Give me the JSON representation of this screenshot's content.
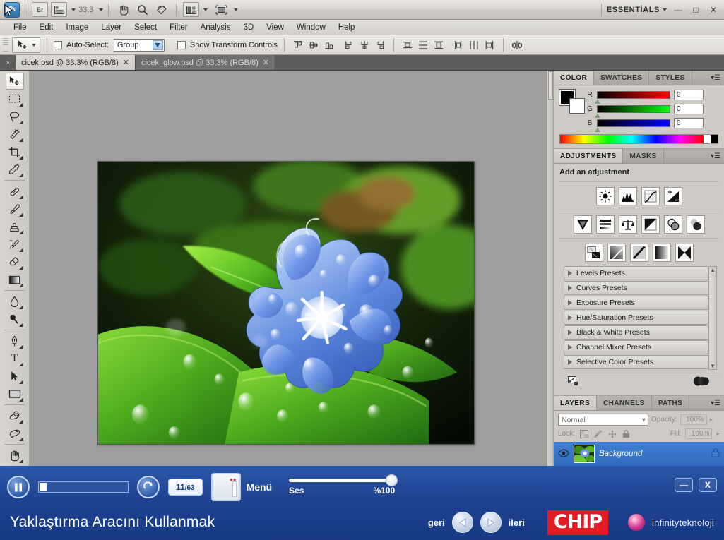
{
  "app": {
    "zoom_value": "33,3",
    "workspace_label": "ESSENTİALS",
    "logo_text": "Ps",
    "bridge_label": "Br"
  },
  "window_controls": {
    "minimize": "—",
    "maximize": "□",
    "close": "✕"
  },
  "menubar": {
    "items": [
      "File",
      "Edit",
      "Image",
      "Layer",
      "Select",
      "Filter",
      "Analysis",
      "3D",
      "View",
      "Window",
      "Help"
    ]
  },
  "options_bar": {
    "auto_select_label": "Auto-Select:",
    "auto_select_value": "Group",
    "show_transform_label": "Show Transform Controls",
    "align_icons": [
      "align-top-edges-icon",
      "align-vertical-centers-icon",
      "align-bottom-edges-icon",
      "align-left-edges-icon",
      "align-horizontal-centers-icon",
      "align-right-edges-icon",
      "distribute-top-edges-icon",
      "distribute-vertical-centers-icon",
      "distribute-bottom-edges-icon",
      "distribute-left-edges-icon",
      "distribute-horizontal-centers-icon",
      "distribute-right-edges-icon",
      "auto-align-layers-icon"
    ]
  },
  "tabs": [
    {
      "label": "cicek.psd @ 33,3% (RGB/8)",
      "active": true,
      "close": "✕"
    },
    {
      "label": "cicek_glow.psd @ 33,3% (RGB/8)",
      "active": false,
      "close": "✕"
    }
  ],
  "toolbox": {
    "tools": [
      {
        "name": "move-tool",
        "glyph": "move",
        "active": true
      },
      {
        "name": "rectangular-marquee-tool",
        "glyph": "marquee"
      },
      {
        "name": "lasso-tool",
        "glyph": "lasso"
      },
      {
        "name": "magic-wand-tool",
        "glyph": "wand"
      },
      {
        "name": "crop-tool",
        "glyph": "crop"
      },
      {
        "name": "eyedropper-tool",
        "glyph": "eyedropper"
      },
      {
        "name": "spot-healing-brush-tool",
        "glyph": "healing"
      },
      {
        "name": "brush-tool",
        "glyph": "brush"
      },
      {
        "name": "clone-stamp-tool",
        "glyph": "stamp"
      },
      {
        "name": "history-brush-tool",
        "glyph": "history"
      },
      {
        "name": "eraser-tool",
        "glyph": "eraser"
      },
      {
        "name": "gradient-tool",
        "glyph": "gradient"
      },
      {
        "name": "blur-tool",
        "glyph": "blur"
      },
      {
        "name": "dodge-tool",
        "glyph": "dodge"
      },
      {
        "name": "pen-tool",
        "glyph": "pen"
      },
      {
        "name": "horizontal-type-tool",
        "glyph": "type"
      },
      {
        "name": "path-selection-tool",
        "glyph": "pathsel"
      },
      {
        "name": "rectangle-tool",
        "glyph": "shape"
      },
      {
        "name": "3d-rotate-tool",
        "glyph": "rotate3d"
      },
      {
        "name": "3d-orbit-tool",
        "glyph": "orbit3d"
      },
      {
        "name": "hand-tool",
        "glyph": "hand"
      },
      {
        "name": "zoom-tool",
        "glyph": "zoom"
      }
    ],
    "foreground_color": "#000000",
    "background_color": "#ffffff"
  },
  "color_panel": {
    "tabs": [
      "COLOR",
      "SWATCHES",
      "STYLES"
    ],
    "active_tab": "COLOR",
    "channels": [
      {
        "label": "R",
        "value": "0",
        "from": "#000000",
        "to": "#ff0000"
      },
      {
        "label": "G",
        "value": "0",
        "from": "#000000",
        "to": "#00ff00"
      },
      {
        "label": "B",
        "value": "0",
        "from": "#000000",
        "to": "#0000ff"
      }
    ]
  },
  "adjustments_panel": {
    "tabs": [
      "ADJUSTMENTS",
      "MASKS"
    ],
    "active_tab": "ADJUSTMENTS",
    "title": "Add an adjustment",
    "row1": [
      "brightness-contrast-icon",
      "levels-icon",
      "curves-icon",
      "exposure-icon"
    ],
    "row2": [
      "vibrance-icon",
      "hue-saturation-icon",
      "color-balance-icon",
      "black-white-icon",
      "photo-filter-icon",
      "channel-mixer-icon"
    ],
    "row3": [
      "invert-icon",
      "posterize-icon",
      "threshold-icon",
      "gradient-map-icon",
      "selective-color-icon"
    ],
    "presets": [
      "Levels Presets",
      "Curves Presets",
      "Exposure Presets",
      "Hue/Saturation Presets",
      "Black & White Presets",
      "Channel Mixer Presets",
      "Selective Color Presets"
    ]
  },
  "layers_panel": {
    "tabs": [
      "LAYERS",
      "CHANNELS",
      "PATHS"
    ],
    "active_tab": "LAYERS",
    "blend_mode": "Normal",
    "opacity_label": "Opacity:",
    "opacity_value": "100%",
    "lock_label": "Lock:",
    "fill_label": "Fill:",
    "fill_value": "100%",
    "lock_icons": [
      "lock-transparent-pixels-icon",
      "lock-image-pixels-icon",
      "lock-position-icon",
      "lock-all-icon"
    ],
    "layers": [
      {
        "name": "Background",
        "visible": true,
        "locked": true
      }
    ]
  },
  "player": {
    "play_state": "pause-icon",
    "replay_icon": "replay-icon",
    "counter_current": "11",
    "counter_total": "/63",
    "menu_label": "Menü",
    "volume_label": "Ses",
    "volume_value": "%100",
    "lesson_title": "Yaklaştırma Aracını Kullanmak",
    "prev_label": "geri",
    "next_label": "ileri",
    "brand_primary": "CHIP",
    "brand_secondary": "infinityteknoloji",
    "brand_color": "#e51b24",
    "overlay_minimize": "—",
    "overlay_close": "X"
  }
}
